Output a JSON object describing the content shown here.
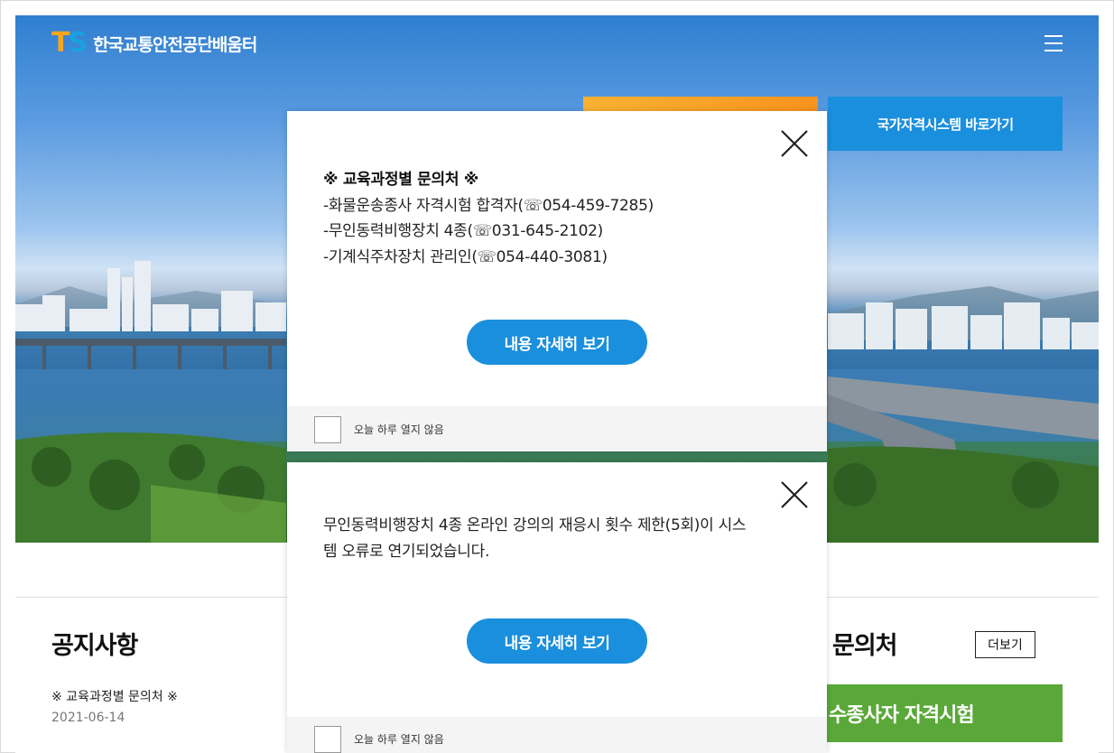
{
  "header": {
    "logo_mark_t": "T",
    "logo_mark_s": "S",
    "site_name": "한국교통안전공단배움터",
    "menu_icon": "hamburger-menu-icon"
  },
  "hero": {
    "quick_link_blue": "국가자격시스템 바로가기"
  },
  "main": {
    "notice_title": "공지사항",
    "notice_item": "※ 교육과정별 문의처 ※",
    "notice_date": "2021-06-14",
    "inquiry_title": "문의처",
    "more_label": "더보기",
    "banner_label": "수종사자 자격시험"
  },
  "popups": [
    {
      "heading": "※ 교육과정별 문의처 ※",
      "lines": [
        "-화물운송종사 자격시험 합격자(☏054-459-7285)",
        "-무인동력비행장치 4종(☏031-645-2102)",
        "-기계식주차장치 관리인(☏054-440-3081)"
      ],
      "button": "내용 자세히 보기",
      "checkbox_label": "오늘 하루 열지 않음"
    },
    {
      "lines": [
        "무인동력비행장치 4종 온라인 강의의 재응시 횟수 제한(5회)이 시스",
        "템 오류로 연기되었습니다."
      ],
      "button": "내용 자세히 보기",
      "checkbox_label": "오늘 하루 열지 않음"
    }
  ],
  "colors": {
    "accent_blue": "#1a8fdd",
    "accent_orange": "#f7931e",
    "banner_green": "#5aa839"
  }
}
